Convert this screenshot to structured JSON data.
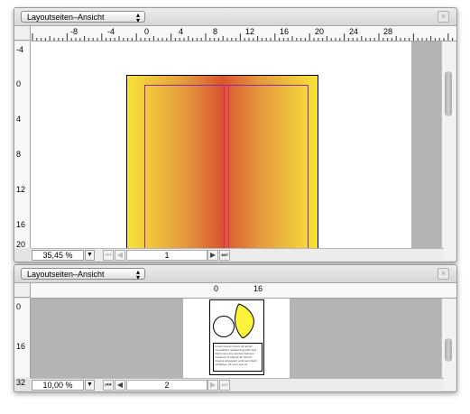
{
  "top_window": {
    "view_selector": {
      "label": "Layoutseiten–Ansicht"
    },
    "ruler_h_labels": [
      "-8",
      "-4",
      "0",
      "4",
      "8",
      "12",
      "16",
      "20",
      "24",
      "28"
    ],
    "ruler_v_labels": [
      "-4",
      "0",
      "4",
      "8",
      "12",
      "16",
      "20"
    ],
    "zoom": "35,45 %",
    "page": "1"
  },
  "bottom_window": {
    "view_selector": {
      "label": "Layoutseiten–Ansicht"
    },
    "ruler_h_labels": [
      "0",
      "16"
    ],
    "ruler_v_labels": [
      "0",
      "16",
      "32"
    ],
    "zoom": "10,00 %",
    "page": "2",
    "thumb_text": "Lorem ipsum dolor sit amet consetetur sadipscing elitr sed diam nonumy eirmod tempor invidunt ut labore et dolore magna aliquyam erat sed diam voluptua. At vero eos et"
  },
  "icons": {
    "close": "close-icon",
    "select_arrows": "updown-arrows-icon",
    "first": "first-page-icon",
    "prev": "prev-page-icon",
    "next": "next-page-icon",
    "last": "last-page-icon",
    "dropdown": "dropdown-icon"
  },
  "colors": {
    "gradient_edge": "#f7e33a",
    "gradient_center": "#d8552f",
    "margin_guide": "#8a2aa8",
    "spine_guide": "#e8207a",
    "pasteboard": "#b4b4b4",
    "thumb_shape": "#fbf33c"
  }
}
